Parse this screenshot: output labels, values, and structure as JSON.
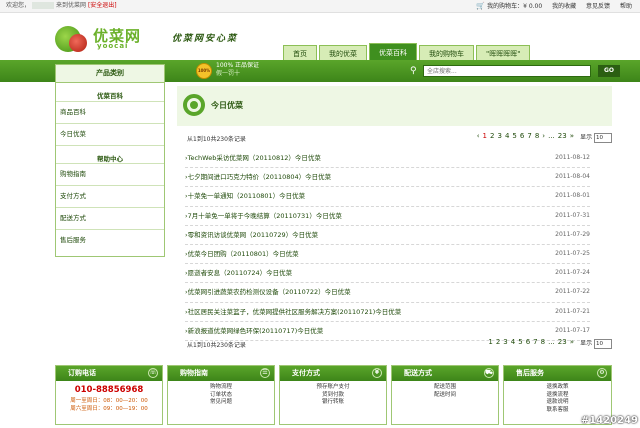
{
  "topbar": {
    "welcome": "欢迎您，",
    "site_welcome": "来到优菜网",
    "logout": "[安全退出]",
    "cart": "我的购物车：¥ 0.00",
    "favorites": "我的收藏",
    "feedback": "意见反馈",
    "help": "帮助"
  },
  "header": {
    "logo_text": "优菜网",
    "logo_sub": "yoocai",
    "slogan": "优菜网安心菜",
    "nav": [
      {
        "label": "首页"
      },
      {
        "label": "我的优菜"
      },
      {
        "label": "优菜百科"
      },
      {
        "label": "我的购物车"
      },
      {
        "label": "\"晖晖晖晖\""
      }
    ],
    "active_nav_index": 2
  },
  "band": {
    "category_title": "产品类别",
    "badge": "100%",
    "guarantee_main": "100% 正品保证",
    "guarantee_sub": "假一罚十",
    "search_placeholder": "全店搜索...",
    "search_button": "GO"
  },
  "sidebar": {
    "section1": "优菜百科",
    "items1": [
      "商品百科",
      "今日优菜"
    ],
    "section2": "帮助中心",
    "items2": [
      "购物指南",
      "支付方式",
      "配送方式",
      "售后服务"
    ]
  },
  "main": {
    "title": "今日优菜",
    "count_text": "从1到10共230条记录",
    "pages_top": [
      "‹",
      "1",
      "2",
      "3",
      "4",
      "5",
      "6",
      "7",
      "8",
      "›",
      "...",
      "23",
      "»"
    ],
    "pages_bottom": [
      "1",
      "2",
      "3",
      "4",
      "5",
      "6",
      "7",
      "8",
      "...",
      "23",
      "»"
    ],
    "show_label": "显示",
    "per_page": "10",
    "items": [
      {
        "title": "TechWeb采访优菜网（20110812）今日优菜",
        "date": "2011-08-12"
      },
      {
        "title": "七夕期间进口巧克力特价（20110804）今日优菜",
        "date": "2011-08-04"
      },
      {
        "title": "十菜免一单通知（20110801）今日优菜",
        "date": "2011-08-01"
      },
      {
        "title": "7月十单免一单将于今晚结算（20110731）今日优菜",
        "date": "2011-07-31"
      },
      {
        "title": "零和资讯访谈优菜网（20110729）今日优菜",
        "date": "2011-07-29"
      },
      {
        "title": "优菜今日团购（20110801）今日优菜",
        "date": "2011-07-25"
      },
      {
        "title": "愿逝者安息（20110724）今日优菜",
        "date": "2011-07-24"
      },
      {
        "title": "优菜网引进蔬菜农药检测仪设备（20110722）今日优菜",
        "date": "2011-07-22"
      },
      {
        "title": "社区居民关注菜篮子，优菜网提供社区服务解决方案(20110721)今日优菜",
        "date": "2011-07-21"
      },
      {
        "title": "新浪报道优菜网绿色环保(20110717)今日优菜",
        "date": "2011-07-17"
      }
    ]
  },
  "footer": {
    "hotline_title": "订购电话",
    "phone": "010-88856968",
    "hours1": "周一至周日：08：00—20：00",
    "hours2": "周六至周日：09：00—19：00",
    "cols": [
      {
        "title": "购物指南",
        "links": [
          "购物流程",
          "订单状态",
          "常见问题"
        ]
      },
      {
        "title": "支付方式",
        "links": [
          "预存账户支付",
          "货到付款",
          "银行转账"
        ]
      },
      {
        "title": "配送方式",
        "links": [
          "配送范围",
          "配送时间"
        ]
      },
      {
        "title": "售后服务",
        "links": [
          "退换政策",
          "退换流程",
          "退款说明",
          "联系客服"
        ]
      }
    ]
  },
  "watermark": "#1420249"
}
